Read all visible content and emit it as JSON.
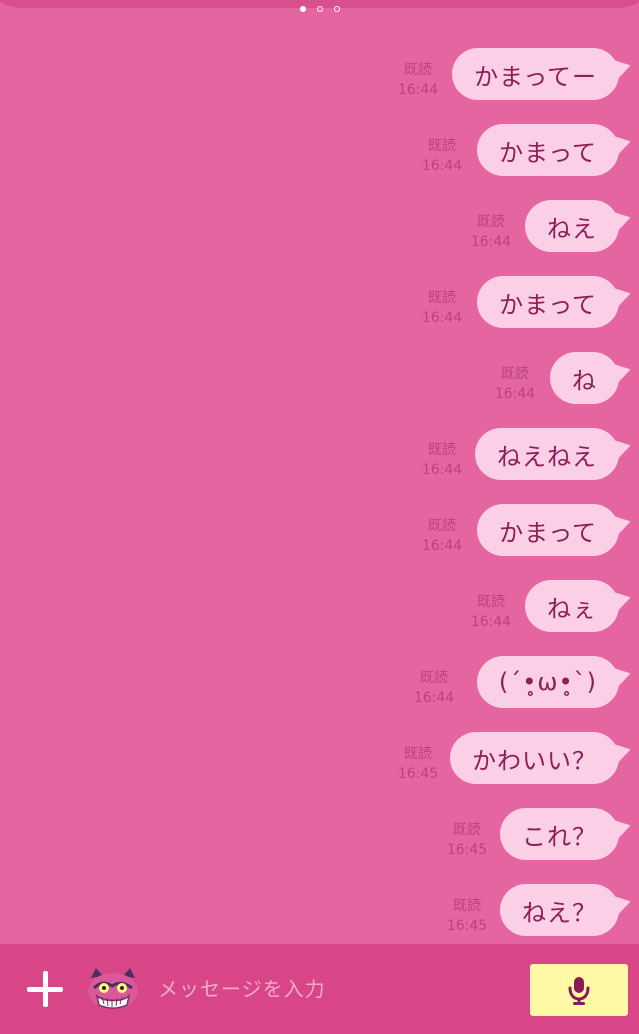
{
  "page_indicator": {
    "count": 3,
    "active_index": 0
  },
  "messages": [
    {
      "text": "かまってー",
      "read": "既読",
      "time": "16:44"
    },
    {
      "text": "かまって",
      "read": "既読",
      "time": "16:44"
    },
    {
      "text": "ねえ",
      "read": "既読",
      "time": "16:44"
    },
    {
      "text": "かまって",
      "read": "既読",
      "time": "16:44"
    },
    {
      "text": "ね",
      "read": "既読",
      "time": "16:44"
    },
    {
      "text": "ねえねえ",
      "read": "既読",
      "time": "16:44"
    },
    {
      "text": "かまって",
      "read": "既読",
      "time": "16:44"
    },
    {
      "text": "ねぇ",
      "read": "既読",
      "time": "16:44"
    },
    {
      "text": "(´•̥ω•̥`)",
      "read": "既読",
      "time": "16:44"
    },
    {
      "text": "かわいい？",
      "read": "既読",
      "time": "16:45"
    },
    {
      "text": "これ？",
      "read": "既読",
      "time": "16:45"
    },
    {
      "text": "ねえ？",
      "read": "既読",
      "time": "16:45"
    }
  ],
  "input_bar": {
    "placeholder": "メッセージを入力",
    "plus_icon": "plus-icon",
    "sticker_icon": "cheshire-cat-sticker-icon",
    "mic_icon": "microphone-icon"
  },
  "colors": {
    "background": "#e565a0",
    "bubble": "#fbd0e6",
    "bubble_text": "#8c1f55",
    "meta_text": "#b8457a",
    "bottom_bar": "#d84687",
    "mic_button": "#fff8a6",
    "mic_icon": "#8a1b59"
  }
}
